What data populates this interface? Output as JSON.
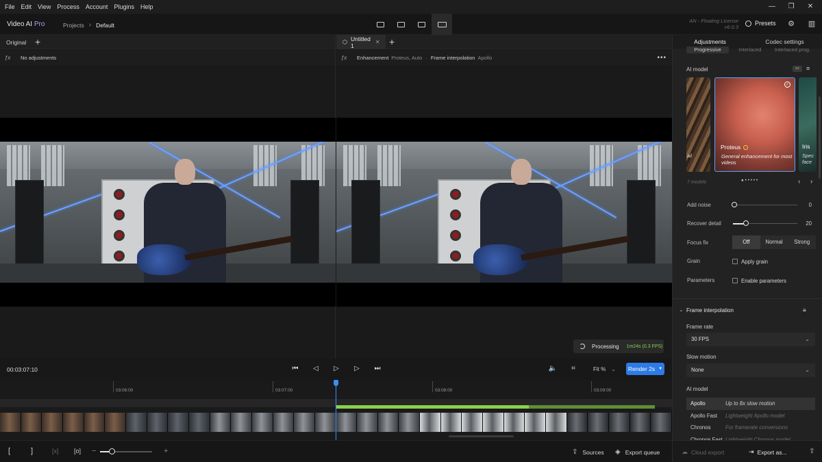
{
  "menu": [
    "File",
    "Edit",
    "View",
    "Process",
    "Account",
    "Plugins",
    "Help"
  ],
  "brand": {
    "name": "Video AI",
    "edition": "Pro"
  },
  "breadcrumb": {
    "root": "Projects",
    "current": "Default"
  },
  "license": {
    "line1": "AN - Floating License",
    "line2": "v6.0.3"
  },
  "presets_label": "Presets",
  "left_pane": {
    "tab": "Original",
    "adjustments": "No adjustments"
  },
  "right_pane": {
    "tab": "Untitled 1",
    "enh_label": "Enhancement",
    "enh_value": "Proteus, Auto",
    "fi_label": "Frame interpolation",
    "fi_value": "Apollo"
  },
  "processing": {
    "label": "Processing",
    "eta": "1m24s (0.3 FPS)"
  },
  "transport": {
    "timecode": "00:03:07:10",
    "fit": "Fit %",
    "render": "Render 2s"
  },
  "timeline": {
    "ticks": [
      "03:06:00",
      "03:07:00",
      "03:08:00",
      "03:09:00"
    ]
  },
  "bottombar": {
    "sources": "Sources",
    "export_queue": "Export queue",
    "cloud_export": "Cloud export",
    "export_as": "Export as..."
  },
  "panel": {
    "tabs": [
      "Adjustments",
      "Codec settings"
    ],
    "scan": [
      "Progressive",
      "Interlaced",
      "Interlaced prog."
    ],
    "ai_model_label": "AI model",
    "model_count": "7 models",
    "selected_model": {
      "name": "Proteus",
      "desc": "General enhancement for most videos"
    },
    "left_card_text": "ail",
    "next_model": {
      "name": "Iris",
      "desc": "Spec face"
    },
    "add_noise": {
      "label": "Add noise",
      "value": "0"
    },
    "recover_detail": {
      "label": "Recover detail",
      "value": "20"
    },
    "focus_fix": {
      "label": "Focus fix",
      "options": [
        "Off",
        "Normal",
        "Strong"
      ],
      "selected": "Off"
    },
    "grain": {
      "label": "Grain",
      "check": "Apply grain"
    },
    "parameters": {
      "label": "Parameters",
      "check": "Enable parameters"
    },
    "frame_interp": {
      "title": "Frame interpolation",
      "frame_rate_label": "Frame rate",
      "frame_rate": "30 FPS",
      "slow_motion_label": "Slow motion",
      "slow_motion": "None",
      "ai_model_label": "AI model",
      "models": [
        {
          "name": "Apollo",
          "desc": "Up to 8x slow motion"
        },
        {
          "name": "Apollo Fast",
          "desc": "Lightweight Apollo model"
        },
        {
          "name": "Chronos",
          "desc": "For framerate conversions"
        },
        {
          "name": "Chronos Fast",
          "desc": "Lightweight Chronos model"
        }
      ]
    }
  }
}
